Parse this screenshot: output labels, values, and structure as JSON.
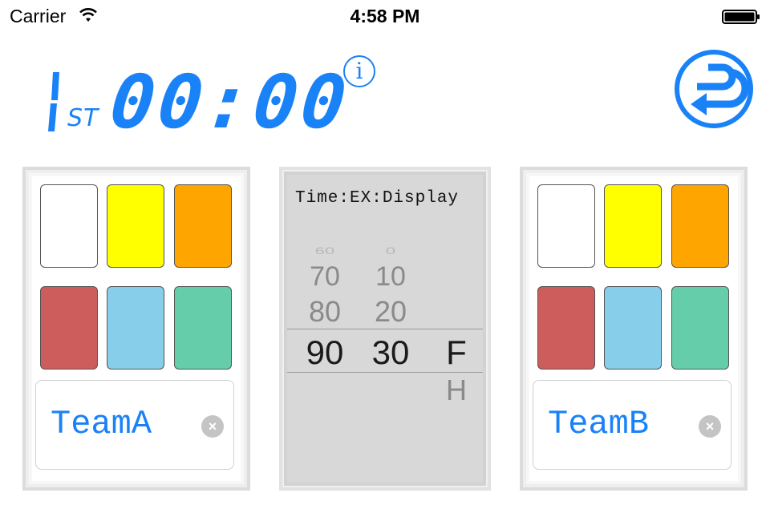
{
  "status_bar": {
    "carrier": "Carrier",
    "time": "4:58 PM"
  },
  "scoreboard": {
    "period_digit": "1",
    "period_suffix": "ST",
    "game_time": "00:00",
    "info_label": "i"
  },
  "teams": {
    "a": {
      "name": "TeamA",
      "swatches": [
        "#ffffff",
        "#ffff00",
        "#ffa500",
        "#cd5c5c",
        "#87ceeb",
        "#66cdaa"
      ]
    },
    "b": {
      "name": "TeamB",
      "swatches": [
        "#ffffff",
        "#ffff00",
        "#ffa500",
        "#cd5c5c",
        "#87ceeb",
        "#66cdaa"
      ]
    }
  },
  "picker": {
    "title": "Time:EX:Display",
    "col1": {
      "far": "60",
      "mid1": "70",
      "mid2": "80",
      "selected": "90"
    },
    "col2": {
      "far": "0",
      "mid1": "10",
      "mid2": "20",
      "selected": "30"
    },
    "col3": {
      "selected": "F",
      "below": "H"
    }
  },
  "colors": {
    "accent": "#1a82f7"
  }
}
